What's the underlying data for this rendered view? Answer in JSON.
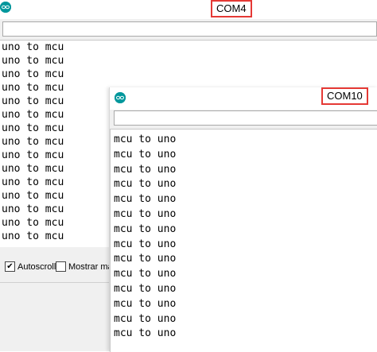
{
  "com4": {
    "title": "COM4",
    "input_value": "",
    "lines": [
      "uno to mcu",
      "uno to mcu",
      "uno to mcu",
      "uno to mcu",
      "uno to mcu",
      "uno to mcu",
      "uno to mcu",
      "uno to mcu",
      "uno to mcu",
      "uno to mcu",
      "uno to mcu",
      "uno to mcu",
      "uno to mcu",
      "uno to mcu",
      "uno to mcu"
    ],
    "autoscroll_label": "Autoscroll",
    "autoscroll_checked": true,
    "timestamp_label": "Mostrar mar",
    "timestamp_checked": false
  },
  "com10": {
    "title": "COM10",
    "input_value": "",
    "lines": [
      "mcu to uno",
      "mcu to uno",
      "mcu to uno",
      "mcu to uno",
      "mcu to uno",
      "mcu to uno",
      "mcu to uno",
      "mcu to uno",
      "mcu to uno",
      "mcu to uno",
      "mcu to uno",
      "mcu to uno",
      "mcu to uno",
      "mcu to uno"
    ]
  },
  "colors": {
    "arduino_teal": "#00979c",
    "highlight_red": "#e53935"
  },
  "icons": [
    "arduino-icon",
    "checkmark-icon"
  ]
}
